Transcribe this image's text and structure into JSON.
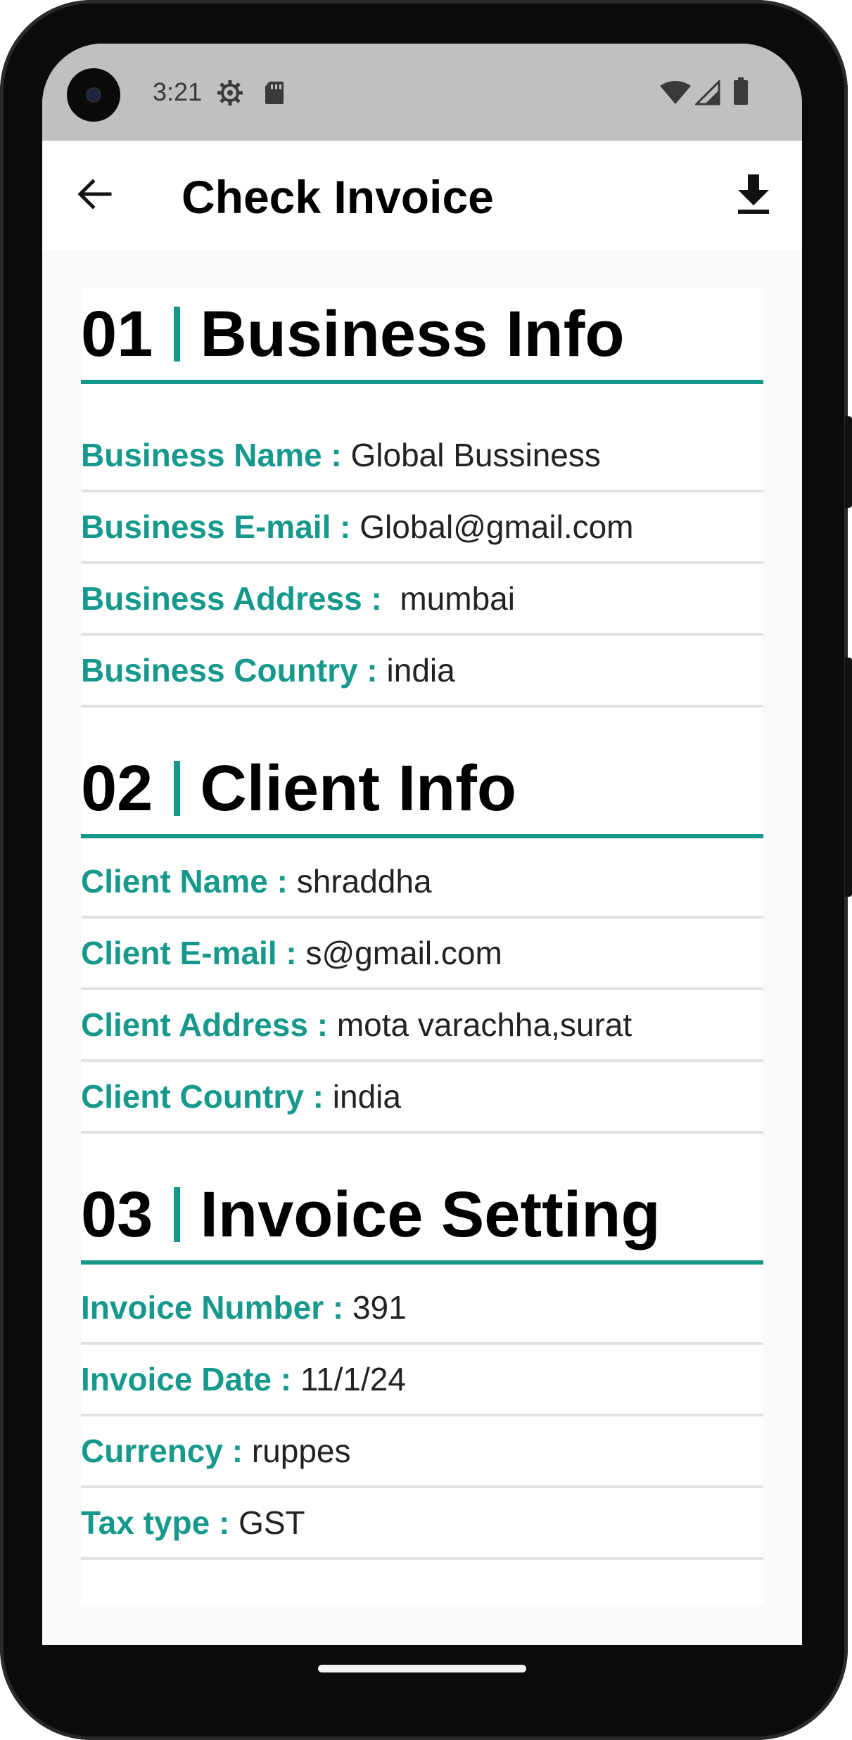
{
  "status_bar": {
    "time": "3:21",
    "left_icons": [
      "settings-icon",
      "sd-card-icon"
    ],
    "right_icons": [
      "wifi-icon",
      "cellular-signal-icon",
      "battery-icon"
    ]
  },
  "app_bar": {
    "title": "Check Invoice",
    "back_icon": "arrow-back-icon",
    "action_icon": "download-icon"
  },
  "accent_color": "#16998c",
  "sections": {
    "business": {
      "number": "01",
      "title": "Business Info",
      "rows": [
        {
          "label": "Business Name : ",
          "value": "Global Bussiness"
        },
        {
          "label": "Business E-mail : ",
          "value": "Global@gmail.com"
        },
        {
          "label": "Business Address : ",
          "value": " mumbai"
        },
        {
          "label": "Business Country : ",
          "value": "india"
        }
      ]
    },
    "client": {
      "number": "02",
      "title": "Client Info",
      "rows": [
        {
          "label": "Client Name : ",
          "value": "shraddha"
        },
        {
          "label": "Client E-mail : ",
          "value": "s@gmail.com"
        },
        {
          "label": "Client Address : ",
          "value": "mota varachha,surat"
        },
        {
          "label": "Client Country : ",
          "value": "india"
        }
      ]
    },
    "invoice": {
      "number": "03",
      "title": "Invoice Setting",
      "rows": [
        {
          "label": "Invoice Number : ",
          "value": "391"
        },
        {
          "label": "Invoice Date : ",
          "value": "11/1/24"
        },
        {
          "label": "Currency : ",
          "value": "ruppes"
        },
        {
          "label": "Tax type : ",
          "value": "GST"
        }
      ]
    }
  }
}
